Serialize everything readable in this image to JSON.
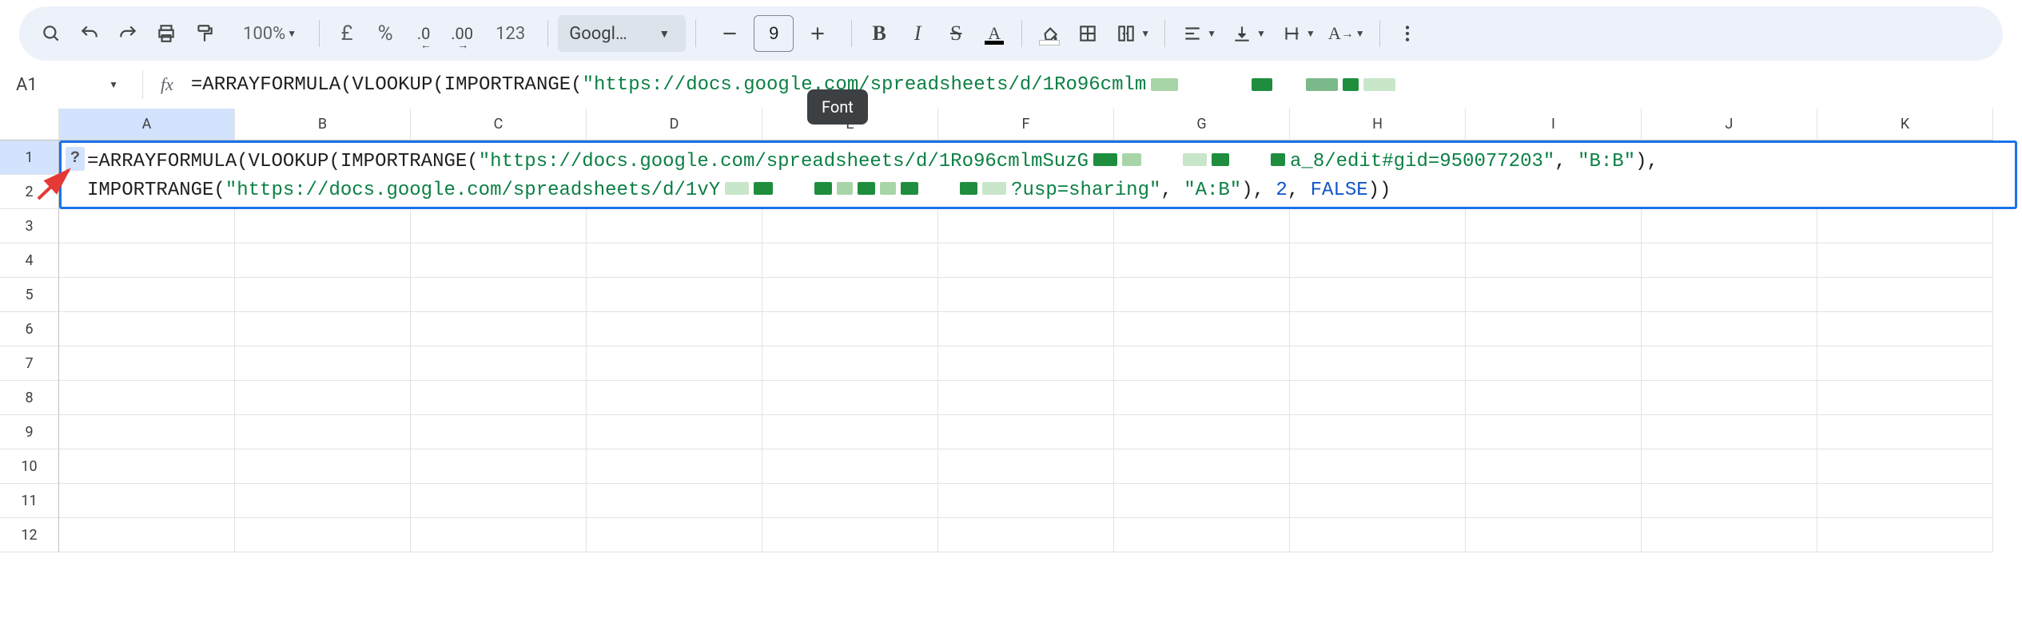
{
  "toolbar": {
    "zoom": "100%",
    "currency_symbol": "£",
    "percent_symbol": "%",
    "dec_decrease_label": ".0",
    "dec_increase_label": ".00",
    "number_format_label": "123",
    "font_name": "Googl…",
    "font_size": "9"
  },
  "tooltip": {
    "text": "Font"
  },
  "namebox": {
    "value": "A1"
  },
  "formula_bar": {
    "prefix": "=ARRAYFORMULA(VLOOKUP(IMPORTRANGE(",
    "url_fragment": "\"https://docs.google.com/spreadsheets/d/1Ro96cmlm"
  },
  "columns": [
    "A",
    "B",
    "C",
    "D",
    "E",
    "F",
    "G",
    "H",
    "I",
    "J",
    "K"
  ],
  "rows": [
    "1",
    "2",
    "3",
    "4",
    "5",
    "6",
    "7",
    "8",
    "9",
    "10",
    "11",
    "12"
  ],
  "cell_edit": {
    "help_badge": "?",
    "line1": {
      "eq": "=",
      "fn1": "ARRAYFORMULA(",
      "fn2": "VLOOKUP(",
      "fn3": "IMPORTRANGE(",
      "str1": "\"https://docs.google.com/spreadsheets/d/1Ro96cmlmSuzG",
      "str1b": "a_8/edit#gid=950077203\"",
      "comma1": ", ",
      "str2": "\"B:B\"",
      "paren_comma": "),"
    },
    "line2": {
      "fn4": "IMPORTRANGE(",
      "str3": "\"https://docs.google.com/spreadsheets/d/1vY",
      "str3b": "?usp=sharing\"",
      "comma2": ", ",
      "str4": "\"A:B\"",
      "paren1": "), ",
      "num": "2",
      "comma3": ", ",
      "kw": "FALSE",
      "close": "))"
    }
  }
}
